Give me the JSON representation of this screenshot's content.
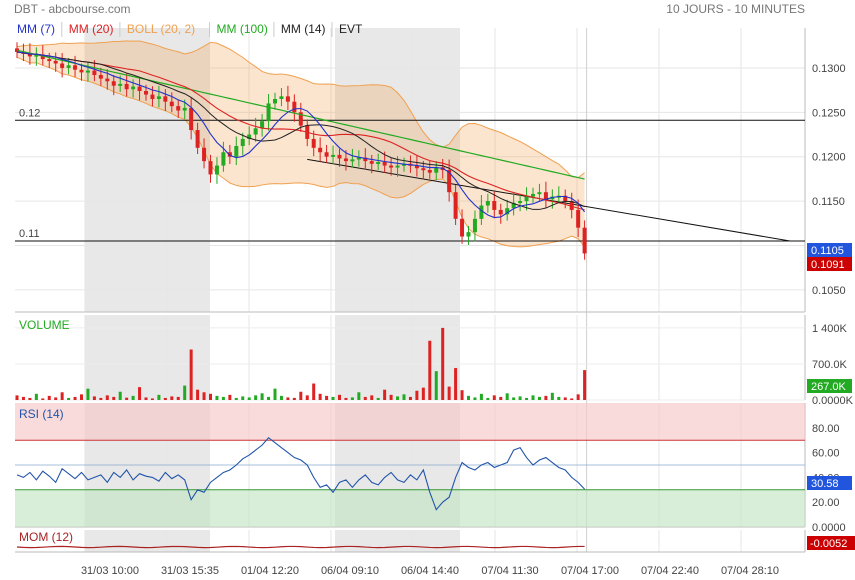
{
  "header": {
    "title": "DBT - abcbourse.com",
    "period": "10 JOURS - 10 MINUTES"
  },
  "colors": {
    "mm7": "#2233cc",
    "mm20": "#dd2222",
    "boll": "#f0a050",
    "mm100": "#22aa22",
    "mm14": "#222222",
    "up": "#22aa22",
    "down": "#dd2222",
    "rsi": "#2255aa",
    "mom": "#aa2222",
    "last_price_blue": "#2255dd",
    "last_price_red": "#cc0000",
    "volume_badge": "#22aa22"
  },
  "legend": [
    {
      "label": "MM (7)",
      "color": "#2233cc"
    },
    {
      "label": "MM (20)",
      "color": "#dd2222"
    },
    {
      "label": "BOLL (20, 2)",
      "color": "#f0a050"
    },
    {
      "label": "MM (100)",
      "color": "#22aa22"
    },
    {
      "label": "MM (14)",
      "color": "#222222"
    },
    {
      "label": "EVT",
      "color": "#222222"
    }
  ],
  "chart_data": {
    "type": "candlestick",
    "title": "DBT - abcbourse.com",
    "x_tick_labels": [
      "31/03 10:00",
      "31/03 15:35",
      "01/04 12:20",
      "06/04 09:10",
      "06/04 14:40",
      "07/04 11:30",
      "07/04 17:00",
      "07/04 22:40",
      "07/04 28:10"
    ],
    "price": {
      "ylim": [
        0.1025,
        0.1345
      ],
      "y_tick_labels": [
        "0.1300",
        "0.1250",
        "0.1200",
        "0.1150",
        "0.1050"
      ],
      "hlines": [
        {
          "label": "0.12",
          "value": 0.1241
        },
        {
          "label": "0.11",
          "value": 0.1105
        }
      ],
      "trendline": {
        "from_bar": 45,
        "from_value": 0.1197,
        "to_bar": 90,
        "to_value": 0.1105
      },
      "last_price_labels": [
        "0.1105",
        "0.1091"
      ],
      "closes": [
        0.1318,
        0.1316,
        0.1313,
        0.1315,
        0.131,
        0.1308,
        0.1305,
        0.13,
        0.1303,
        0.1298,
        0.1295,
        0.1297,
        0.1292,
        0.1288,
        0.1285,
        0.128,
        0.1282,
        0.1276,
        0.1279,
        0.1274,
        0.127,
        0.1265,
        0.1268,
        0.1262,
        0.1257,
        0.1252,
        0.1255,
        0.123,
        0.121,
        0.1195,
        0.118,
        0.119,
        0.1205,
        0.12,
        0.1212,
        0.122,
        0.1225,
        0.1232,
        0.124,
        0.126,
        0.1265,
        0.1268,
        0.1262,
        0.125,
        0.1235,
        0.122,
        0.121,
        0.1205,
        0.12,
        0.1202,
        0.1198,
        0.1195,
        0.1197,
        0.1199,
        0.1195,
        0.1192,
        0.1194,
        0.119,
        0.1188,
        0.119,
        0.1192,
        0.119,
        0.1187,
        0.1185,
        0.1182,
        0.1188,
        0.1185,
        0.116,
        0.113,
        0.111,
        0.1115,
        0.113,
        0.1145,
        0.115,
        0.114,
        0.1135,
        0.1142,
        0.1148,
        0.115,
        0.1155,
        0.1158,
        0.116,
        0.1152,
        0.1155,
        0.1156,
        0.115,
        0.114,
        0.112,
        0.1091
      ]
    },
    "volume": {
      "y_tick_labels": [
        "1 400K",
        "700.0K",
        "0.0000K"
      ],
      "ymax": 1650,
      "last_label": "267.0K",
      "values": [
        90,
        60,
        40,
        120,
        30,
        80,
        50,
        150,
        40,
        60,
        110,
        220,
        70,
        40,
        90,
        60,
        160,
        45,
        80,
        250,
        50,
        30,
        100,
        40,
        70,
        60,
        280,
        980,
        200,
        150,
        120,
        80,
        60,
        100,
        40,
        70,
        50,
        90,
        130,
        60,
        220,
        80,
        50,
        40,
        160,
        90,
        320,
        120,
        80,
        60,
        100,
        40,
        50,
        150,
        60,
        90,
        40,
        200,
        100,
        70,
        110,
        60,
        180,
        240,
        1150,
        560,
        1400,
        260,
        620,
        190,
        80,
        50,
        120,
        40,
        90,
        60,
        130,
        50,
        70,
        40,
        90,
        60,
        80,
        140,
        60,
        50,
        30,
        110,
        580
      ]
    },
    "rsi": {
      "label": "RSI (14)",
      "y_tick_labels": [
        "80.00",
        "60.00",
        "40.00",
        "20.00",
        "0.0000"
      ],
      "upper": 70,
      "lower": 30,
      "last_label": "30.58",
      "values": [
        42,
        40,
        44,
        38,
        45,
        41,
        36,
        47,
        43,
        39,
        44,
        38,
        40,
        42,
        36,
        44,
        40,
        46,
        38,
        43,
        41,
        40,
        37,
        44,
        39,
        42,
        38,
        22,
        30,
        28,
        36,
        40,
        44,
        46,
        50,
        55,
        58,
        62,
        66,
        72,
        68,
        64,
        60,
        56,
        54,
        50,
        40,
        32,
        34,
        28,
        36,
        38,
        32,
        38,
        42,
        36,
        34,
        40,
        44,
        38,
        36,
        42,
        38,
        46,
        28,
        14,
        20,
        24,
        40,
        52,
        48,
        46,
        50,
        52,
        48,
        50,
        52,
        62,
        64,
        56,
        50,
        54,
        56,
        52,
        48,
        46,
        40,
        36,
        30.58
      ]
    },
    "mom": {
      "label": "MOM (12)",
      "last_label": "-0.0052"
    }
  }
}
